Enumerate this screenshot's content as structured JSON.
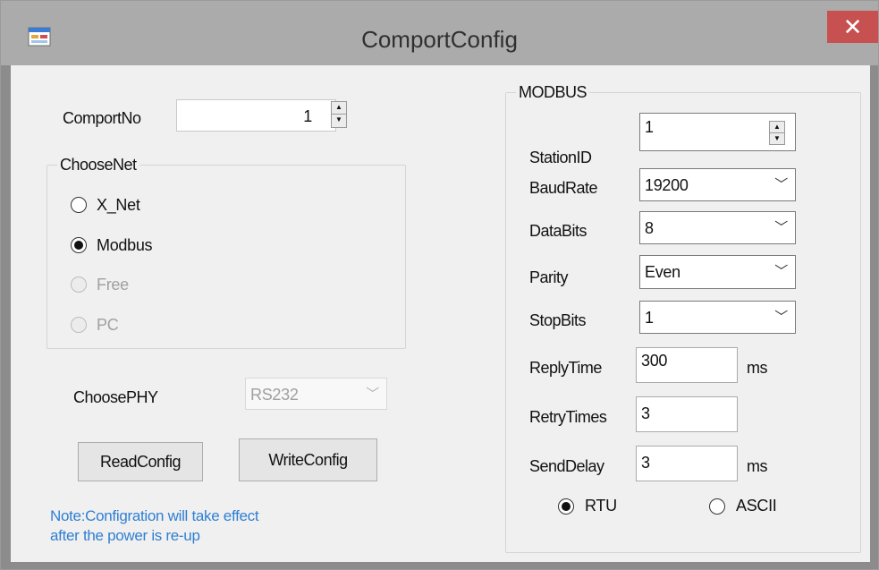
{
  "window": {
    "title": "ComportConfig",
    "close_glyph": "✕",
    "icon": "application-icon"
  },
  "comport": {
    "label": "ComportNo",
    "value": "1"
  },
  "choose_net": {
    "legend": "ChooseNet",
    "options": [
      {
        "label": "X_Net",
        "checked": false,
        "enabled": true
      },
      {
        "label": "Modbus",
        "checked": true,
        "enabled": true
      },
      {
        "label": "Free",
        "checked": false,
        "enabled": false
      },
      {
        "label": "PC",
        "checked": false,
        "enabled": false
      }
    ]
  },
  "choose_phy": {
    "label": "ChoosePHY",
    "value": "RS232",
    "enabled": false
  },
  "buttons": {
    "read": "ReadConfig",
    "write": "WriteConfig"
  },
  "note": {
    "line1": "Note:Configration will take effect",
    "line2": "after the power is re-up"
  },
  "modbus": {
    "legend": "MODBUS",
    "station_id": {
      "label": "StationID",
      "value": "1"
    },
    "baud_rate": {
      "label": "BaudRate",
      "value": "19200"
    },
    "data_bits": {
      "label": "DataBits",
      "value": "8"
    },
    "parity": {
      "label": "Parity",
      "value": "Even"
    },
    "stop_bits": {
      "label": "StopBits",
      "value": "1"
    },
    "reply_time": {
      "label": "ReplyTime",
      "value": "300",
      "unit": "ms"
    },
    "retry_times": {
      "label": "RetryTimes",
      "value": "3"
    },
    "send_delay": {
      "label": "SendDelay",
      "value": "3",
      "unit": "ms"
    },
    "mode": [
      {
        "label": "RTU",
        "checked": true
      },
      {
        "label": "ASCII",
        "checked": false
      }
    ]
  },
  "colors": {
    "title_bar": "#ababab",
    "close_button": "#c75050",
    "client_background": "#f0f0f0",
    "note_text": "#2f7fd3"
  }
}
